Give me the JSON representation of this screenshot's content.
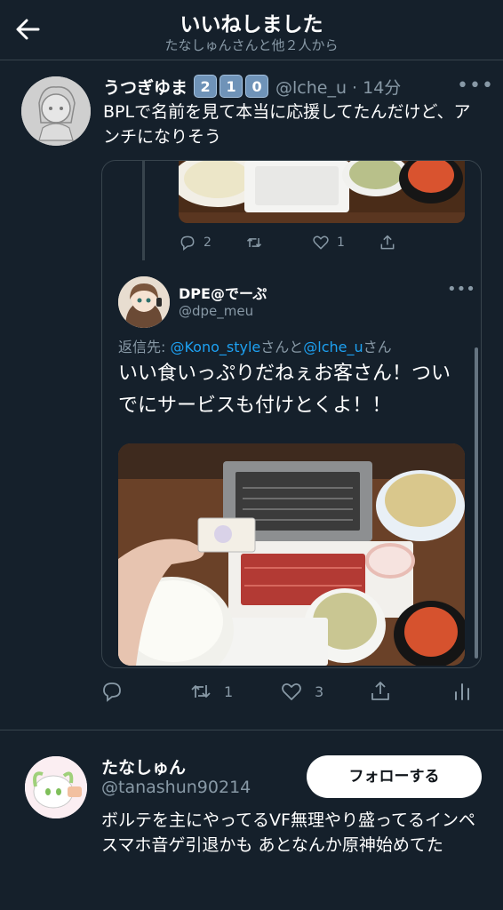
{
  "header": {
    "title": "いいねしました",
    "subtitle": "たなしゅんさんと他２人から"
  },
  "tweet": {
    "author_name": "うつぎゆま",
    "badges": [
      "2",
      "1",
      "0"
    ],
    "handle_time": "@lche_u · 14分",
    "text": "BPLで名前を見て本当に応援してたんだけど、アンチになりそう",
    "quoted_thread": {
      "parent_reply_count": "2",
      "parent_like_count": "1",
      "author_name": "DPE@でーぷ",
      "handle": "@dpe_meu",
      "reply_prefix": "返信先: ",
      "reply_mention1": "@Kono_style",
      "reply_mid": "さんと",
      "reply_mention2": "@lche_u",
      "reply_suffix": "さん",
      "text": "いい食いっぷりだねぇお客さん！ついでにサービスも付けとくよ！！"
    },
    "retweet_count": "1",
    "like_count": "3"
  },
  "liker": {
    "name": "たなしゅん",
    "handle": "@tanashun90214",
    "follow_label": "フォローする",
    "bio": "ボルテを主にやってるVF無理やり盛ってるインペ スマホ音ゲ引退かも あとなんか原神始めてた"
  },
  "colors": {
    "background": "#15202b",
    "secondary_text": "#8899a6",
    "link": "#1da1f2",
    "border": "#38444d"
  }
}
